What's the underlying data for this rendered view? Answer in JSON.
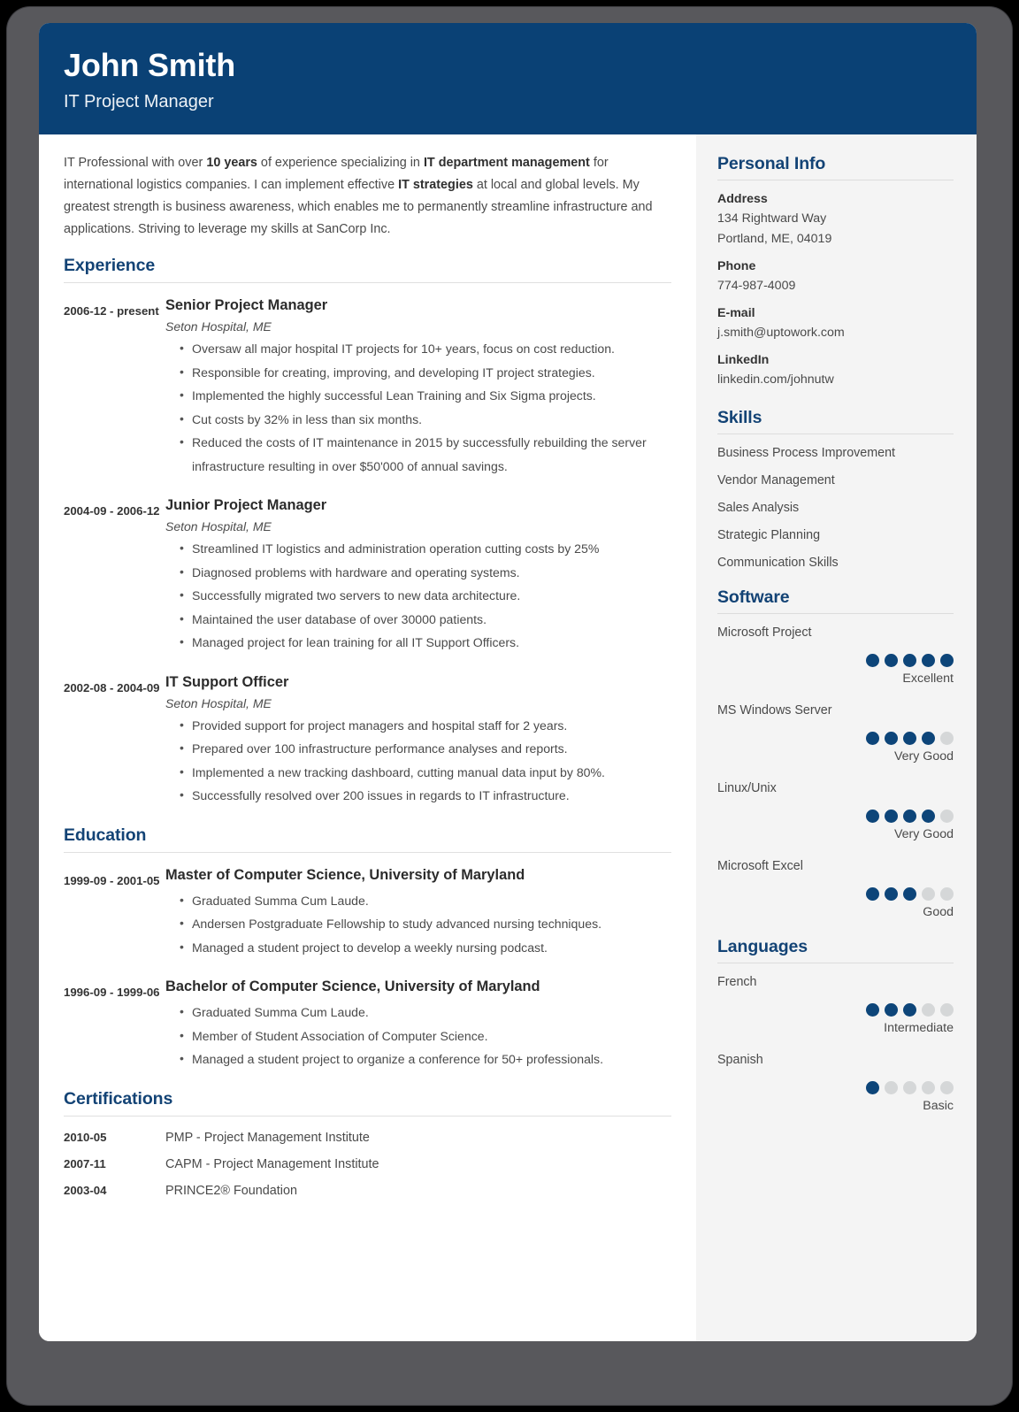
{
  "header": {
    "name": "John Smith",
    "role": "IT Project Manager",
    "bg_color": "#0a4175"
  },
  "summary": {
    "parts": [
      {
        "text": "IT Professional with over ",
        "bold": false
      },
      {
        "text": "10 years",
        "bold": true
      },
      {
        "text": " of experience specializing in ",
        "bold": false
      },
      {
        "text": "IT department management",
        "bold": true
      },
      {
        "text": " for international logistics companies. I can implement effective ",
        "bold": false
      },
      {
        "text": "IT strategies",
        "bold": true
      },
      {
        "text": " at local and global levels. My greatest strength is business awareness, which enables me to permanently streamline infrastructure and applications. Striving to leverage my skills at SanCorp Inc.",
        "bold": false
      }
    ]
  },
  "experience": {
    "title": "Experience",
    "entries": [
      {
        "dates": "2006-12 - present",
        "title": "Senior Project Manager",
        "org": "Seton Hospital, ME",
        "bullets": [
          "Oversaw all major hospital IT projects for 10+ years, focus on cost reduction.",
          "Responsible for creating, improving, and developing IT project strategies.",
          "Implemented the highly successful Lean Training and Six Sigma projects.",
          "Cut costs by 32% in less than six months.",
          "Reduced the costs of IT maintenance in 2015 by successfully rebuilding the server infrastructure resulting in over $50'000 of annual savings."
        ]
      },
      {
        "dates": "2004-09 - 2006-12",
        "title": "Junior Project Manager",
        "org": "Seton Hospital, ME",
        "bullets": [
          "Streamlined IT logistics and administration operation cutting costs by 25%",
          "Diagnosed problems with hardware and operating systems.",
          "Successfully migrated two servers to new data architecture.",
          "Maintained the user database of over 30000 patients.",
          "Managed project for lean training for all IT Support Officers."
        ]
      },
      {
        "dates": "2002-08 - 2004-09",
        "title": "IT Support Officer",
        "org": "Seton Hospital, ME",
        "bullets": [
          "Provided support for project managers and hospital staff for 2 years.",
          "Prepared over 100 infrastructure performance analyses and reports.",
          "Implemented a new tracking dashboard, cutting manual data input by 80%.",
          "Successfully resolved over 200 issues in regards to IT infrastructure."
        ]
      }
    ]
  },
  "education": {
    "title": "Education",
    "entries": [
      {
        "dates": "1999-09 - 2001-05",
        "title": "Master of Computer Science, University of Maryland",
        "org": "",
        "bullets": [
          "Graduated Summa Cum Laude.",
          "Andersen Postgraduate Fellowship to study advanced nursing techniques.",
          "Managed a student project to develop a weekly nursing podcast."
        ]
      },
      {
        "dates": "1996-09 - 1999-06",
        "title": "Bachelor of Computer Science, University of Maryland",
        "org": "",
        "bullets": [
          "Graduated Summa Cum Laude.",
          "Member of Student Association of Computer Science.",
          "Managed a student project to organize a conference for 50+ professionals."
        ]
      }
    ]
  },
  "certifications": {
    "title": "Certifications",
    "rows": [
      {
        "date": "2010-05",
        "name": "PMP - Project Management Institute"
      },
      {
        "date": "2007-11",
        "name": "CAPM - Project Management Institute"
      },
      {
        "date": "2003-04",
        "name": "PRINCE2® Foundation"
      }
    ]
  },
  "personal_info": {
    "title": "Personal Info",
    "fields": [
      {
        "label": "Address",
        "values": [
          "134 Rightward Way",
          "Portland, ME, 04019"
        ]
      },
      {
        "label": "Phone",
        "values": [
          "774-987-4009"
        ]
      },
      {
        "label": "E-mail",
        "values": [
          "j.smith@uptowork.com"
        ]
      },
      {
        "label": "LinkedIn",
        "values": [
          "linkedin.com/johnutw"
        ]
      }
    ]
  },
  "skills": {
    "title": "Skills",
    "items": [
      "Business Process Improvement",
      "Vendor Management",
      "Sales Analysis",
      "Strategic Planning",
      "Communication Skills"
    ]
  },
  "software": {
    "title": "Software",
    "max_dots": 5,
    "items": [
      {
        "name": "Microsoft Project",
        "level": 5,
        "label": "Excellent"
      },
      {
        "name": "MS Windows Server",
        "level": 4,
        "label": "Very Good"
      },
      {
        "name": "Linux/Unix",
        "level": 4,
        "label": "Very Good"
      },
      {
        "name": "Microsoft Excel",
        "level": 3,
        "label": "Good"
      }
    ]
  },
  "languages": {
    "title": "Languages",
    "max_dots": 5,
    "items": [
      {
        "name": "French",
        "level": 3,
        "label": "Intermediate"
      },
      {
        "name": "Spanish",
        "level": 1,
        "label": "Basic"
      }
    ]
  },
  "colors": {
    "accent": "#134375",
    "header_bg": "#0a4175",
    "dot_on": "#0d4579",
    "dot_off": "#d5d7d8",
    "sidebar_bg": "#f4f4f4",
    "frame": "#58585c"
  }
}
